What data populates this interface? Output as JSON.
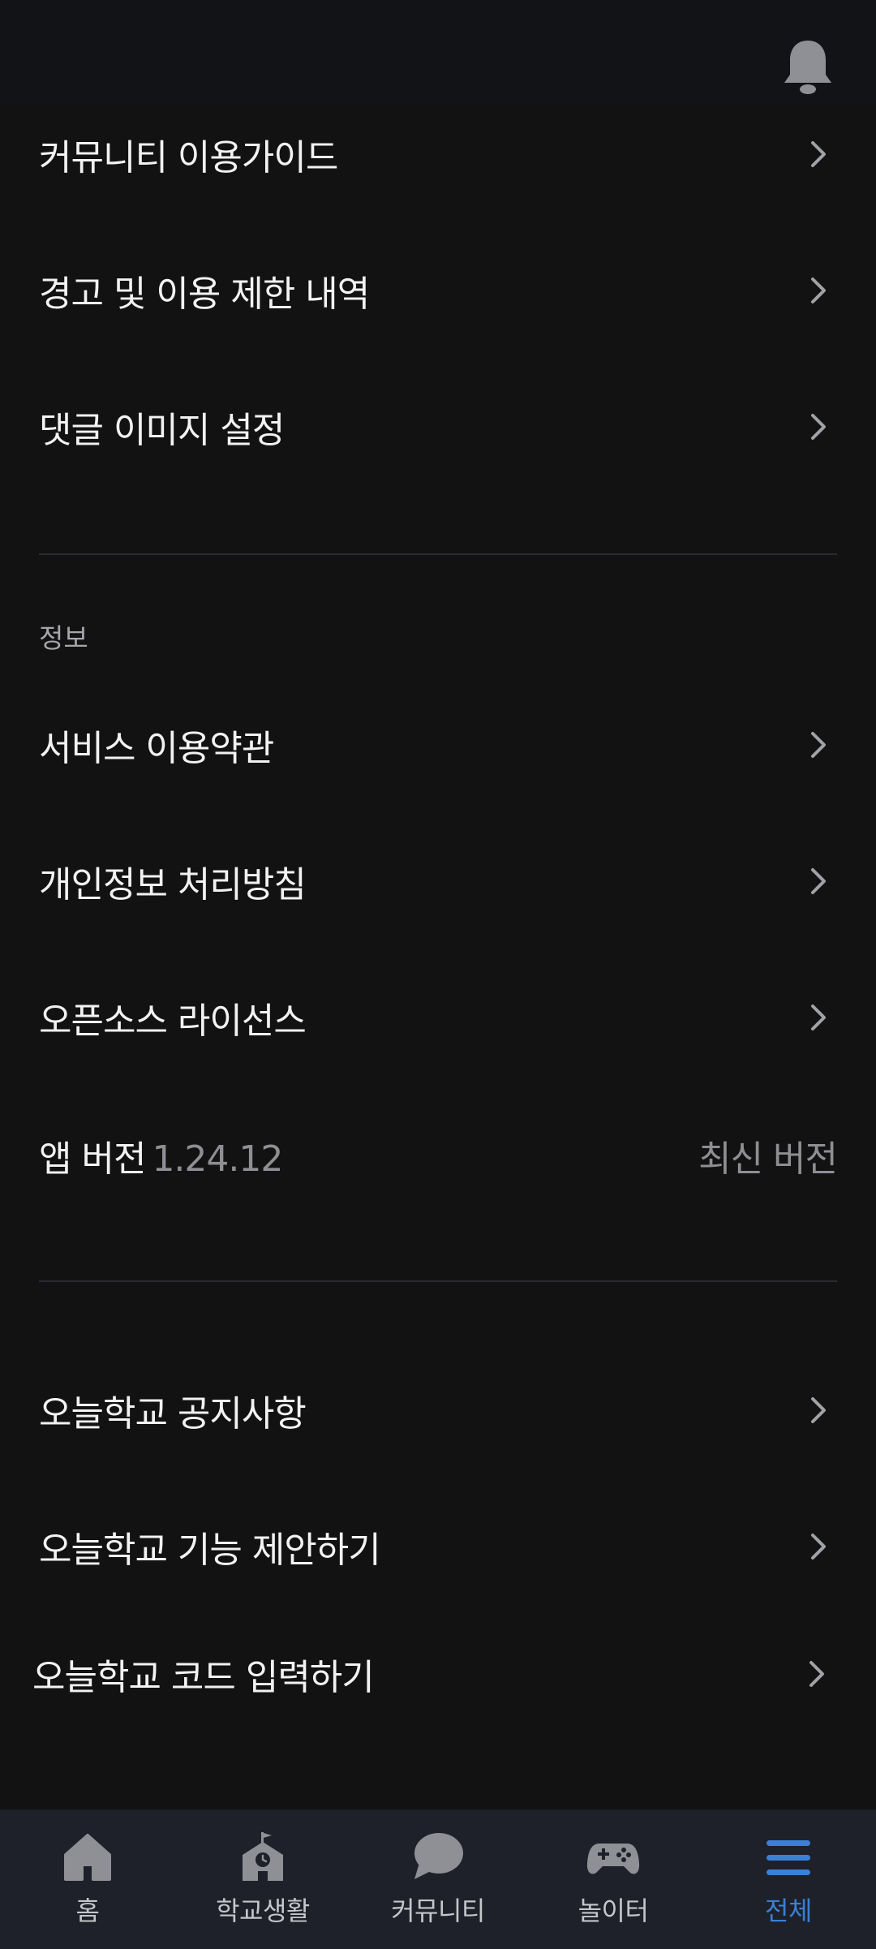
{
  "header": {
    "bell_icon": "bell-icon"
  },
  "menu": {
    "community_guide": "커뮤니티 이용가이드",
    "warning_history": "경고 및 이용 제한 내역",
    "comment_image_settings": "댓글 이미지 설정"
  },
  "info": {
    "section_title": "정보",
    "terms": "서비스 이용약관",
    "privacy": "개인정보 처리방침",
    "open_source": "오픈소스 라이선스",
    "version_label": "앱 버전",
    "version_number": "1.24.12",
    "version_status": "최신 버전"
  },
  "school": {
    "notices": "오늘학교 공지사항",
    "suggest": "오늘학교 기능 제안하기",
    "code": "오늘학교 코드 입력하기"
  },
  "tabbar": {
    "items": [
      {
        "label": "홈",
        "icon": "home-icon"
      },
      {
        "label": "학교생활",
        "icon": "school-icon"
      },
      {
        "label": "커뮤니티",
        "icon": "chat-bubble-icon"
      },
      {
        "label": "놀이터",
        "icon": "gamepad-icon"
      },
      {
        "label": "전체",
        "icon": "menu-icon"
      }
    ],
    "active_index": 4
  },
  "colors": {
    "background": "#121212",
    "tabbar_background": "#1e2129",
    "accent": "#3b7fd6",
    "text_primary": "#f2f2f2",
    "text_secondary": "#8e8e93",
    "icon_gray": "#8e9096"
  }
}
